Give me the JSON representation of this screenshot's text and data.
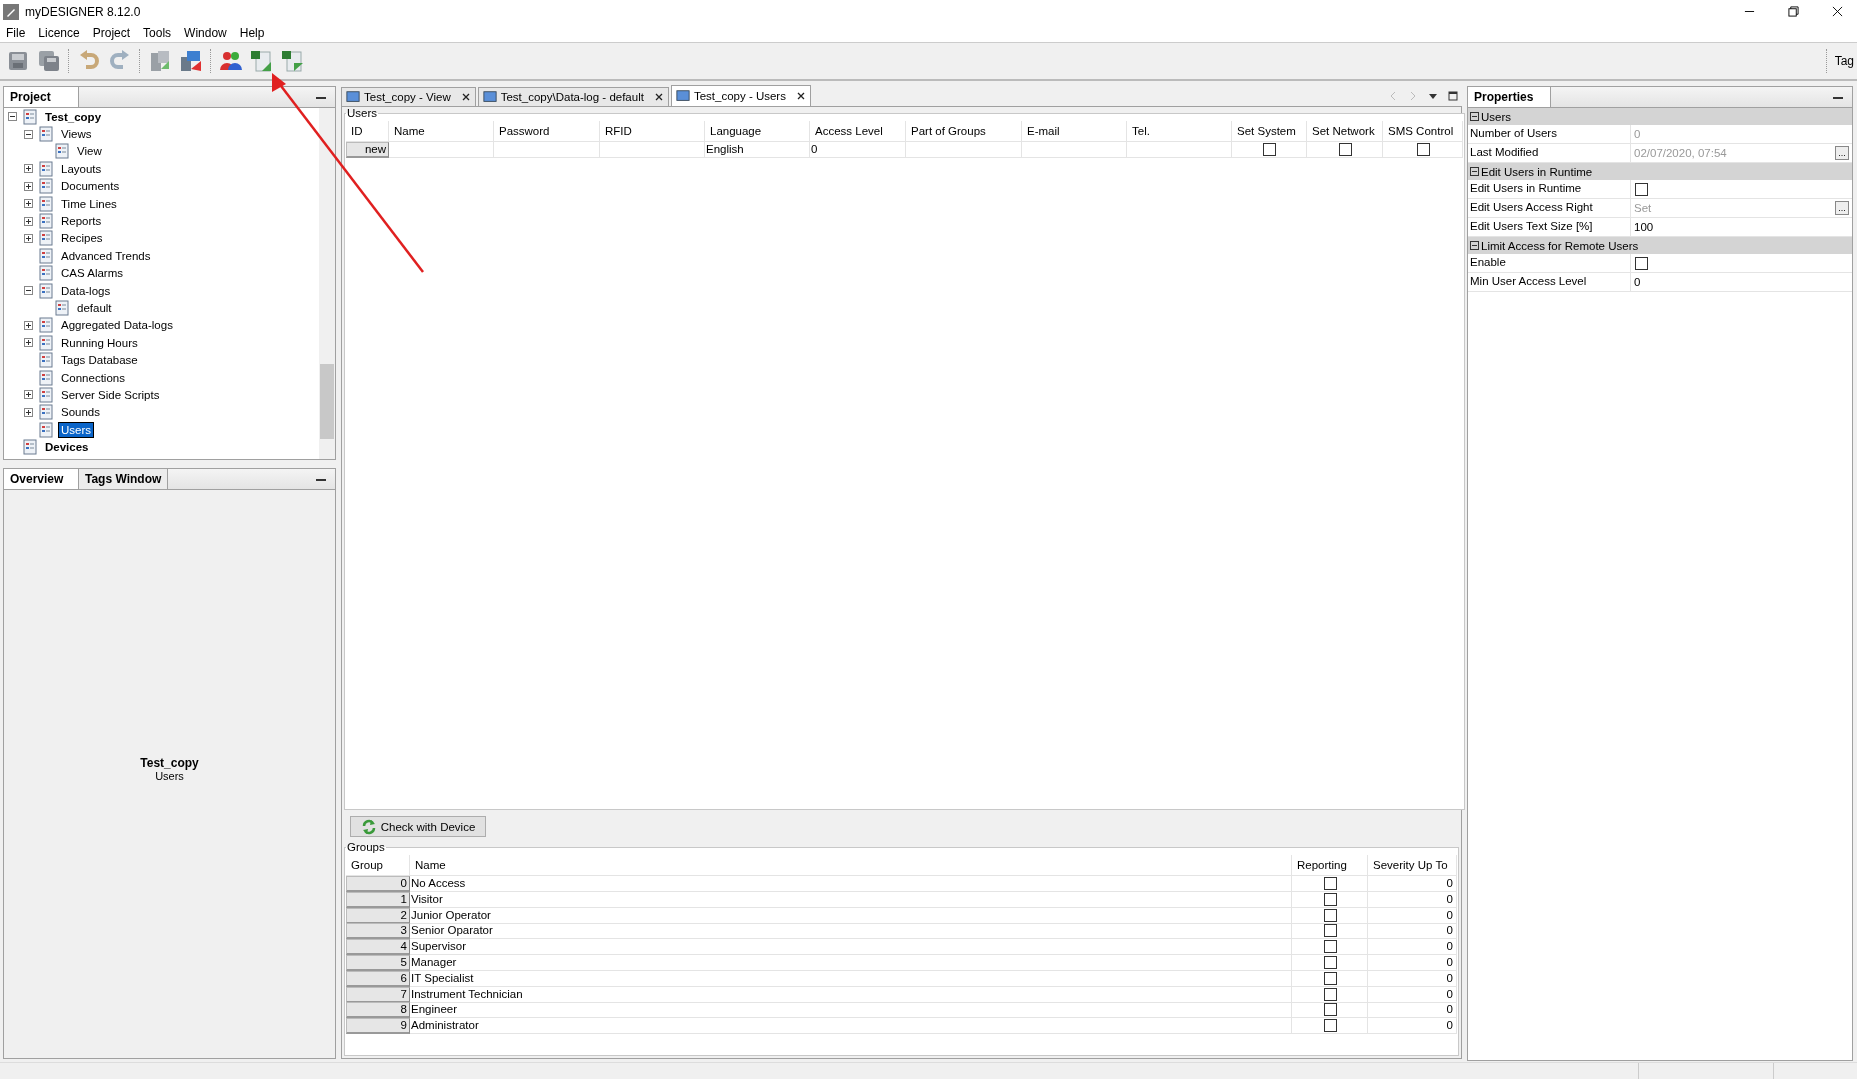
{
  "window": {
    "title": "myDESIGNER 8.12.0"
  },
  "menu": [
    "File",
    "Licence",
    "Project",
    "Tools",
    "Window",
    "Help"
  ],
  "toolbar": {
    "right_label": "Tag"
  },
  "project_panel": {
    "title": "Project"
  },
  "project_tree": [
    {
      "label": "Test_copy",
      "selected": false,
      "expanded": true,
      "children": [
        {
          "label": "Views",
          "selected": false,
          "expanded": true,
          "children": [
            {
              "label": "View",
              "selected": false
            }
          ]
        },
        {
          "label": "Layouts",
          "selected": false,
          "expanded": false
        },
        {
          "label": "Documents",
          "selected": false,
          "expanded": false
        },
        {
          "label": "Time Lines",
          "selected": false,
          "expanded": false
        },
        {
          "label": "Reports",
          "selected": false,
          "expanded": false
        },
        {
          "label": "Recipes",
          "selected": false,
          "expanded": false
        },
        {
          "label": "Advanced Trends",
          "selected": false
        },
        {
          "label": "CAS Alarms",
          "selected": false
        },
        {
          "label": "Data-logs",
          "selected": false,
          "expanded": true,
          "children": [
            {
              "label": "default",
              "selected": false
            }
          ]
        },
        {
          "label": "Aggregated Data-logs",
          "selected": false,
          "expanded": false
        },
        {
          "label": "Running Hours",
          "selected": false,
          "expanded": false
        },
        {
          "label": "Tags Database",
          "selected": false
        },
        {
          "label": "Connections",
          "selected": false
        },
        {
          "label": "Server Side Scripts",
          "selected": false,
          "expanded": false
        },
        {
          "label": "Sounds",
          "selected": false,
          "expanded": false
        },
        {
          "label": "Users",
          "selected": true
        }
      ]
    },
    {
      "label": "Devices",
      "selected": false
    }
  ],
  "bottom_panel": {
    "tabs": [
      {
        "label": "Overview",
        "selected": true
      },
      {
        "label": "Tags Window",
        "selected": false
      }
    ],
    "overview_title": "Test_copy",
    "overview_subtitle": "Users"
  },
  "editor_tabs": [
    {
      "label": "Test_copy - View",
      "selected": false
    },
    {
      "label": "Test_copy\\Data-log - default",
      "selected": false
    },
    {
      "label": "Test_copy - Users",
      "selected": true
    }
  ],
  "users": {
    "title": "Users",
    "columns": [
      "ID",
      "Name",
      "Password",
      "RFID",
      "Language",
      "Access Level",
      "Part of Groups",
      "E-mail",
      "Tel.",
      "Set System",
      "Set Network",
      "SMS Control"
    ],
    "rows": [
      {
        "cells": [
          {
            "kind": "header",
            "text": "new"
          },
          {
            "kind": "blank"
          },
          {
            "kind": "blank"
          },
          {
            "kind": "blank"
          },
          {
            "kind": "text",
            "text": "English"
          },
          {
            "kind": "text",
            "text": "0"
          },
          {
            "kind": "blank"
          },
          {
            "kind": "blank"
          },
          {
            "kind": "blank"
          },
          {
            "kind": "check",
            "checked": false
          },
          {
            "kind": "check",
            "checked": false
          },
          {
            "kind": "check",
            "checked": false
          }
        ]
      }
    ]
  },
  "check_button": "Check with Device",
  "groups": {
    "title": "Groups",
    "columns": [
      "Group",
      "Name",
      "Reporting",
      "Severity Up To"
    ],
    "rows": [
      {
        "group": "0",
        "name": "No Access",
        "reporting": false,
        "severity": "0"
      },
      {
        "group": "1",
        "name": "Visitor",
        "reporting": false,
        "severity": "0"
      },
      {
        "group": "2",
        "name": "Junior Operator",
        "reporting": false,
        "severity": "0"
      },
      {
        "group": "3",
        "name": "Senior Oparator",
        "reporting": false,
        "severity": "0"
      },
      {
        "group": "4",
        "name": "Supervisor",
        "reporting": false,
        "severity": "0"
      },
      {
        "group": "5",
        "name": "Manager",
        "reporting": false,
        "severity": "0"
      },
      {
        "group": "6",
        "name": "IT Specialist",
        "reporting": false,
        "severity": "0"
      },
      {
        "group": "7",
        "name": "Instrument Technician",
        "reporting": false,
        "severity": "0"
      },
      {
        "group": "8",
        "name": "Engineer",
        "reporting": false,
        "severity": "0"
      },
      {
        "group": "9",
        "name": "Administrator",
        "reporting": false,
        "severity": "0"
      }
    ]
  },
  "properties": {
    "title": "Properties",
    "sections": [
      {
        "title": "Users",
        "expanded": true,
        "rows": [
          {
            "label": "Number of Users",
            "kind": "text",
            "value": "0",
            "disabled": true
          },
          {
            "label": "Last Modified",
            "kind": "text",
            "value": "02/07/2020, 07:54",
            "disabled": true,
            "button": "..."
          }
        ]
      },
      {
        "title": "Edit Users in Runtime",
        "expanded": true,
        "rows": [
          {
            "label": "Edit Users in Runtime",
            "kind": "check",
            "checked": false
          },
          {
            "label": "Edit Users Access Right",
            "kind": "text",
            "value": "Set",
            "disabled": true,
            "button": "..."
          },
          {
            "label": "Edit Users Text Size [%]",
            "kind": "text",
            "value": "100",
            "disabled": false
          }
        ]
      },
      {
        "title": "Limit Access for Remote Users",
        "expanded": true,
        "rows": [
          {
            "label": "Enable",
            "kind": "check",
            "checked": false
          },
          {
            "label": "Min User Access Level",
            "kind": "text",
            "value": "0",
            "disabled": false
          }
        ]
      }
    ]
  }
}
